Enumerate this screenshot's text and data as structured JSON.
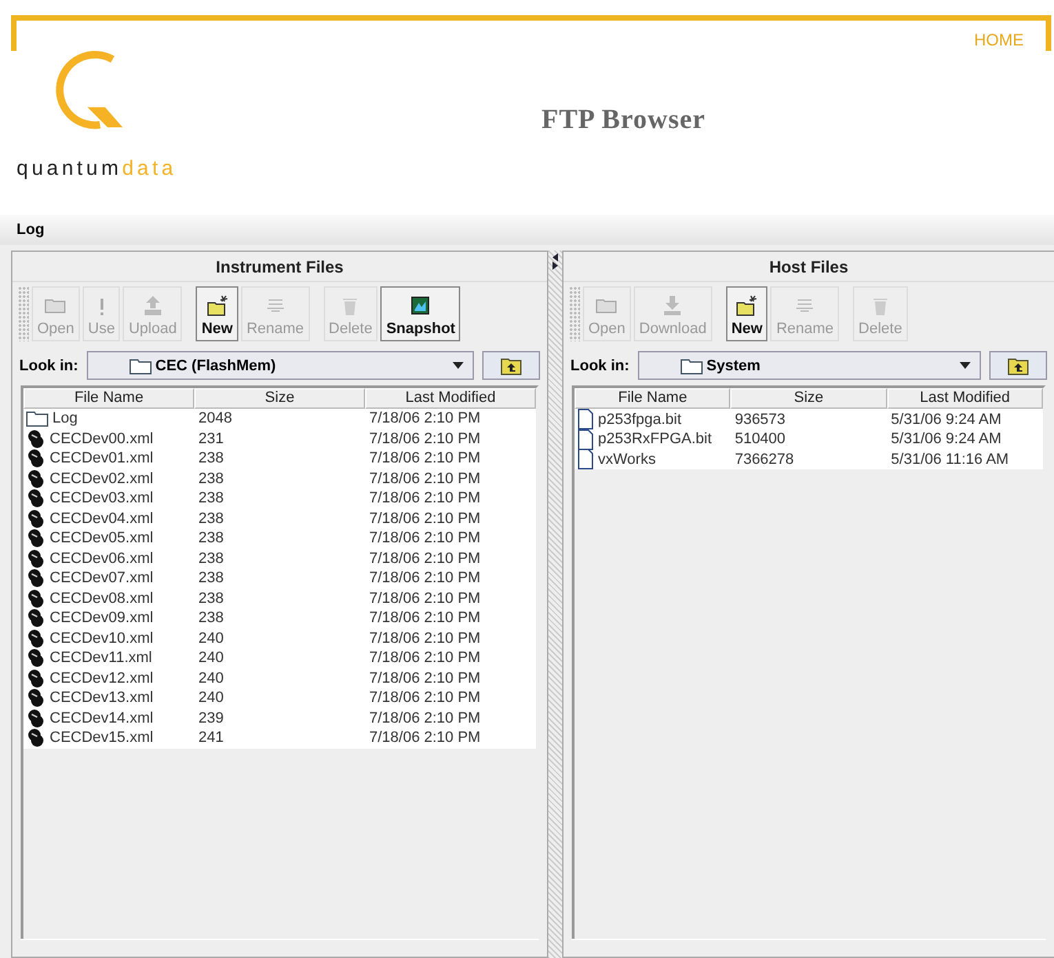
{
  "header": {
    "home_link": "HOME",
    "logo_words": [
      "quantum",
      "data"
    ],
    "title": "FTP Browser"
  },
  "log_bar": {
    "label": "Log"
  },
  "panels": [
    {
      "title": "Instrument Files",
      "toolbar": [
        {
          "label": "Open",
          "kind": "open",
          "enabled": false
        },
        {
          "label": "Use",
          "kind": "use",
          "enabled": false
        },
        {
          "label": "Upload",
          "kind": "upload",
          "enabled": false
        },
        {
          "label": "New",
          "kind": "new",
          "enabled": true
        },
        {
          "label": "Rename",
          "kind": "rename",
          "enabled": false
        },
        {
          "label": "Delete",
          "kind": "delete",
          "enabled": false
        },
        {
          "label": "Snapshot",
          "kind": "snapshot",
          "enabled": true
        }
      ],
      "look_in": {
        "label": "Look in:",
        "value": "CEC  (FlashMem)"
      },
      "columns": [
        "File Name",
        "Size",
        "Last Modified"
      ],
      "rows": [
        {
          "kind": "folder",
          "name": "Log",
          "size": "2048",
          "modified": "7/18/06 2:10 PM"
        },
        {
          "kind": "cec",
          "name": "CECDev00.xml",
          "size": "231",
          "modified": "7/18/06 2:10 PM"
        },
        {
          "kind": "cec",
          "name": "CECDev01.xml",
          "size": "238",
          "modified": "7/18/06 2:10 PM"
        },
        {
          "kind": "cec",
          "name": "CECDev02.xml",
          "size": "238",
          "modified": "7/18/06 2:10 PM"
        },
        {
          "kind": "cec",
          "name": "CECDev03.xml",
          "size": "238",
          "modified": "7/18/06 2:10 PM"
        },
        {
          "kind": "cec",
          "name": "CECDev04.xml",
          "size": "238",
          "modified": "7/18/06 2:10 PM"
        },
        {
          "kind": "cec",
          "name": "CECDev05.xml",
          "size": "238",
          "modified": "7/18/06 2:10 PM"
        },
        {
          "kind": "cec",
          "name": "CECDev06.xml",
          "size": "238",
          "modified": "7/18/06 2:10 PM"
        },
        {
          "kind": "cec",
          "name": "CECDev07.xml",
          "size": "238",
          "modified": "7/18/06 2:10 PM"
        },
        {
          "kind": "cec",
          "name": "CECDev08.xml",
          "size": "238",
          "modified": "7/18/06 2:10 PM"
        },
        {
          "kind": "cec",
          "name": "CECDev09.xml",
          "size": "238",
          "modified": "7/18/06 2:10 PM"
        },
        {
          "kind": "cec",
          "name": "CECDev10.xml",
          "size": "240",
          "modified": "7/18/06 2:10 PM"
        },
        {
          "kind": "cec",
          "name": "CECDev11.xml",
          "size": "240",
          "modified": "7/18/06 2:10 PM"
        },
        {
          "kind": "cec",
          "name": "CECDev12.xml",
          "size": "240",
          "modified": "7/18/06 2:10 PM"
        },
        {
          "kind": "cec",
          "name": "CECDev13.xml",
          "size": "240",
          "modified": "7/18/06 2:10 PM"
        },
        {
          "kind": "cec",
          "name": "CECDev14.xml",
          "size": "239",
          "modified": "7/18/06 2:10 PM"
        },
        {
          "kind": "cec",
          "name": "CECDev15.xml",
          "size": "241",
          "modified": "7/18/06 2:10 PM"
        }
      ]
    },
    {
      "title": "Host Files",
      "toolbar": [
        {
          "label": "Open",
          "kind": "open",
          "enabled": false
        },
        {
          "label": "Download",
          "kind": "download",
          "enabled": false
        },
        {
          "label": "New",
          "kind": "new",
          "enabled": true
        },
        {
          "label": "Rename",
          "kind": "rename",
          "enabled": false
        },
        {
          "label": "Delete",
          "kind": "delete",
          "enabled": false
        }
      ],
      "look_in": {
        "label": "Look in:",
        "value": "System"
      },
      "columns": [
        "File Name",
        "Size",
        "Last Modified"
      ],
      "rows": [
        {
          "kind": "file",
          "name": "p253fpga.bit",
          "size": "936573",
          "modified": "5/31/06 9:24 AM"
        },
        {
          "kind": "file",
          "name": "p253RxFPGA.bit",
          "size": "510400",
          "modified": "5/31/06 9:24 AM"
        },
        {
          "kind": "file",
          "name": "vxWorks",
          "size": "7366278",
          "modified": "5/31/06 11:16 AM"
        }
      ]
    }
  ]
}
